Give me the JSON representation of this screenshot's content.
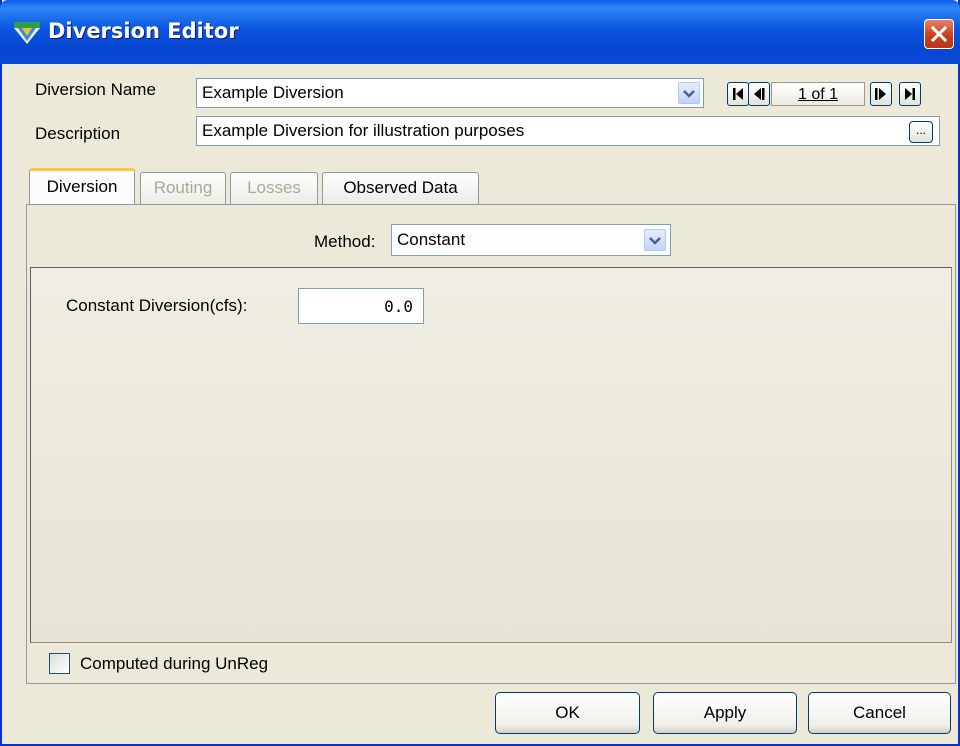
{
  "window": {
    "title": "Diversion Editor"
  },
  "form": {
    "name_label": "Diversion Name",
    "name_value": "Example Diversion",
    "description_label": "Description",
    "description_value": "Example Diversion for illustration purposes",
    "ellipsis_label": "...",
    "page_indicator": "1 of 1"
  },
  "tabs": [
    {
      "label": "Diversion",
      "state": "active"
    },
    {
      "label": "Routing",
      "state": "disabled"
    },
    {
      "label": "Losses",
      "state": "disabled"
    },
    {
      "label": "Observed Data",
      "state": "enabled"
    }
  ],
  "method": {
    "label": "Method:",
    "value": "Constant"
  },
  "constant": {
    "label": "Constant Diversion(cfs):",
    "value": "0.0"
  },
  "checkbox": {
    "label": "Computed during UnReg",
    "checked": false
  },
  "buttons": {
    "ok": "OK",
    "apply": "Apply",
    "cancel": "Cancel"
  },
  "colors": {
    "titlebar": "#0A5FEA",
    "window_bg": "#ECE9D8",
    "close": "#C9401E",
    "active_tab_highlight": "#FFC83C"
  }
}
